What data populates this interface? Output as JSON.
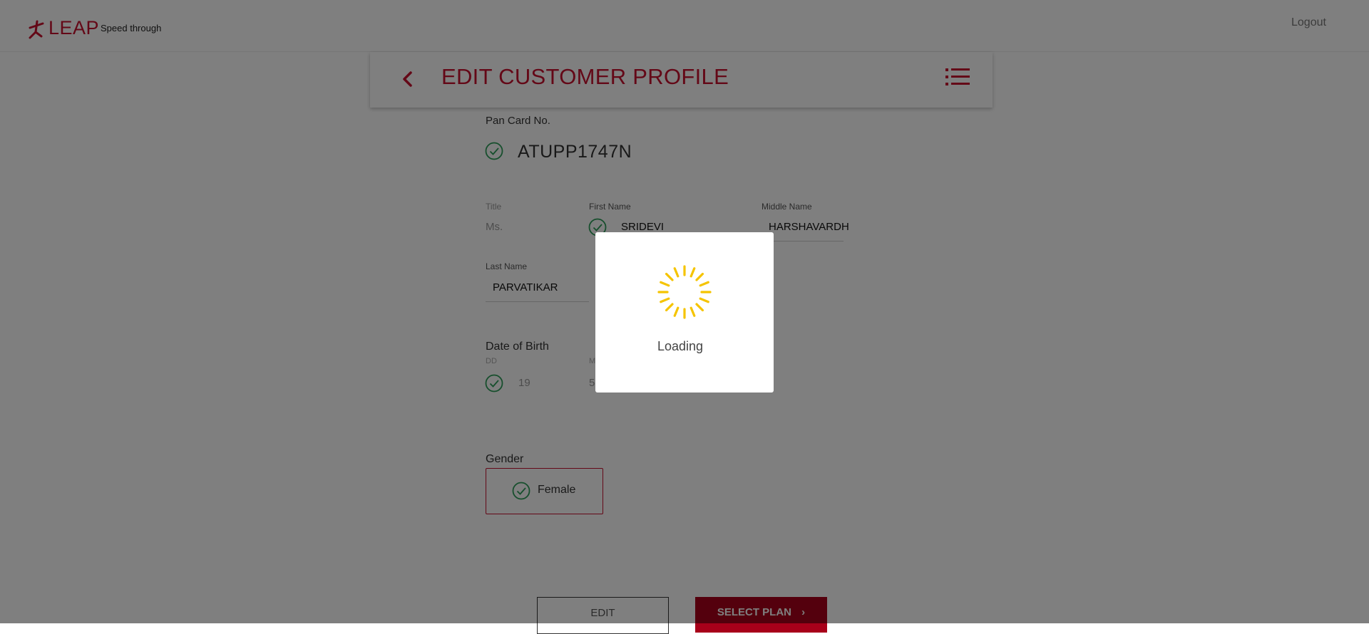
{
  "brand": {
    "logo_text": "LEAP",
    "tagline": "Speed through",
    "color": "#c8102e"
  },
  "header": {
    "logout_label": "Logout",
    "title": "EDIT CUSTOMER PROFILE"
  },
  "form": {
    "pan": {
      "label": "Pan Card No.",
      "value": "ATUPP1747N",
      "verified": true
    },
    "title": {
      "label": "Title",
      "value": "Ms."
    },
    "first_name": {
      "label": "First Name",
      "value": "SRIDEVI",
      "verified": true
    },
    "middle_name": {
      "label": "Middle Name",
      "value": "HARSHAVARDH"
    },
    "last_name": {
      "label": "Last Name",
      "value": "PARVATIKAR"
    },
    "dob": {
      "label": "Date of Birth",
      "dd_label": "DD",
      "dd_value": "19",
      "mm_label": "M",
      "mm_value": "5",
      "verified": true
    },
    "gender": {
      "label": "Gender",
      "value": "Female",
      "verified": true
    }
  },
  "actions": {
    "edit_label": "EDIT",
    "select_plan_label": "SELECT PLAN"
  },
  "modal": {
    "loading_label": "Loading",
    "spinner_color": "#f5c400"
  },
  "colors": {
    "accent": "#c8102e",
    "check": "#2e9e5b",
    "button_primary": "#a8001a"
  }
}
